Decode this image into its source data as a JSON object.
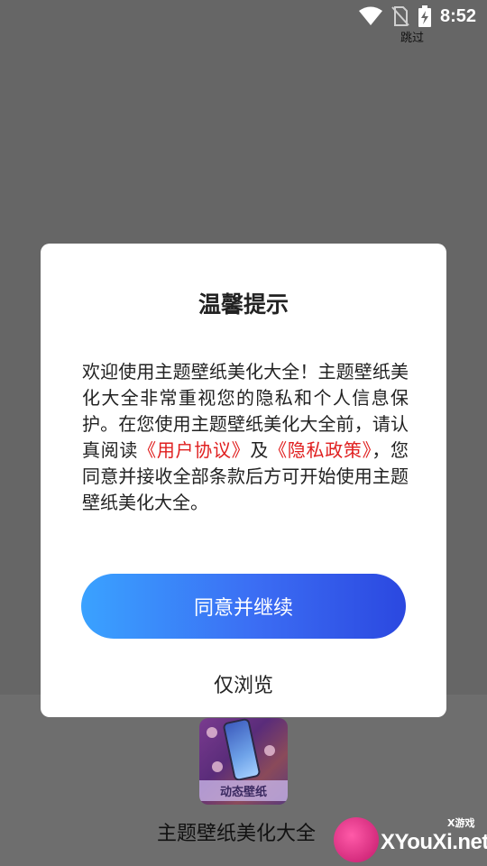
{
  "status_bar": {
    "time": "8:52",
    "skip_label": "跳过"
  },
  "dialog": {
    "title": "温馨提示",
    "body_before": "欢迎使用主题壁纸美化大全！主题壁纸美化大全非常重视您的隐私和个人信息保护。在您使用主题壁纸美化大全前，请认真阅读",
    "user_agreement_link": "《用户协议》",
    "connector": "及",
    "privacy_policy_link": "《隐私政策》",
    "body_after": "，您同意并接收全部条款后方可开始使用主题壁纸美化大全。",
    "agree_button": "同意并继续",
    "browse_button": "仅浏览"
  },
  "app": {
    "icon_tag": "动态壁纸",
    "name": "主题壁纸美化大全"
  },
  "watermark": {
    "text": "XYouXi.net",
    "sub": "X游戏"
  },
  "colors": {
    "link": "#e02020",
    "button_gradient_start": "#3aa2ff",
    "button_gradient_end": "#2b48e0"
  }
}
